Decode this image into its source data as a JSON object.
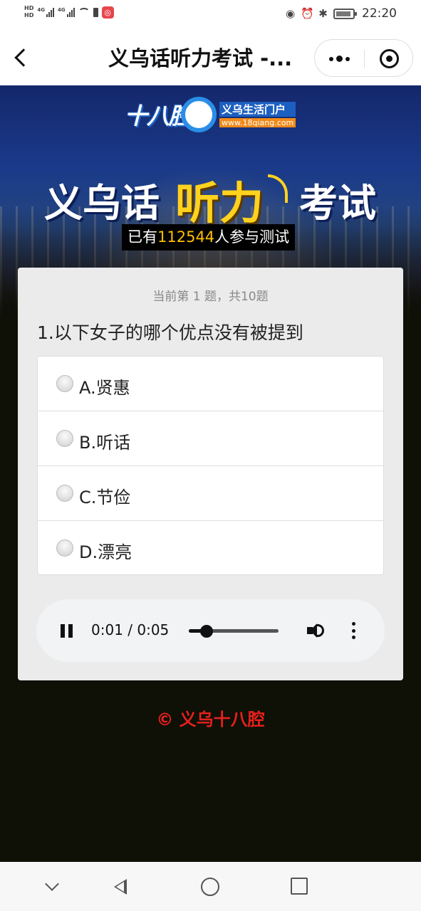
{
  "status_bar": {
    "hd_labels": [
      "HD",
      "HD"
    ],
    "network": [
      "4G",
      "4G"
    ],
    "time": "22:20",
    "icons": [
      "eye-icon",
      "alarm-icon",
      "bluetooth-icon",
      "battery-icon"
    ]
  },
  "nav": {
    "title": "义乌话听力考试 -...",
    "icons": [
      "back-arrow-icon",
      "more-dots-icon",
      "close-miniprogram-icon"
    ]
  },
  "banner": {
    "logo_main": "十八腔",
    "logo_tagline": "义乌生活门户",
    "logo_url": "www.18qiang.com",
    "title_part1": "义乌话",
    "title_highlight": "听力",
    "title_part2": "考试",
    "participants_prefix": "已有",
    "participants_count": "112544",
    "participants_suffix": "人参与测试"
  },
  "quiz": {
    "progress": "当前第 1 题，共10题",
    "question": "1.以下女子的哪个优点没有被提到",
    "options": [
      {
        "label": "A.贤惠",
        "selected": false
      },
      {
        "label": "B.听话",
        "selected": false
      },
      {
        "label": "C.节俭",
        "selected": false
      },
      {
        "label": "D.漂亮",
        "selected": false
      }
    ]
  },
  "audio": {
    "state": "playing",
    "time_display": "0:01 / 0:05",
    "progress_fraction": 0.2,
    "icons": [
      "pause-icon",
      "volume-icon",
      "more-vert-icon"
    ]
  },
  "footer": {
    "copyright": "© 义乌十八腔"
  },
  "colors": {
    "accent_yellow": "#ffd21e",
    "count_orange": "#ffbf00",
    "footer_red": "#e8201c",
    "page_bg": "#0f1006"
  }
}
